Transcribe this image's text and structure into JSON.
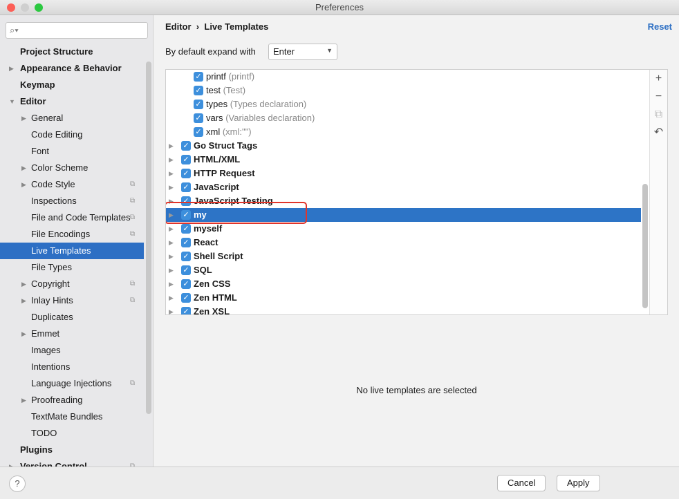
{
  "window": {
    "title": "Preferences"
  },
  "search": {
    "placeholder": "",
    "icon": "search-icon"
  },
  "sidebar": {
    "items": [
      {
        "label": "Project Structure",
        "level": 0,
        "bold": true,
        "arrow": ""
      },
      {
        "label": "Appearance & Behavior",
        "level": 0,
        "bold": true,
        "arrow": "▶"
      },
      {
        "label": "Keymap",
        "level": 0,
        "bold": true,
        "arrow": ""
      },
      {
        "label": "Editor",
        "level": 0,
        "bold": true,
        "arrow": "▼"
      },
      {
        "label": "General",
        "level": 1,
        "arrow": "▶"
      },
      {
        "label": "Code Editing",
        "level": 1,
        "arrow": ""
      },
      {
        "label": "Font",
        "level": 1,
        "arrow": ""
      },
      {
        "label": "Color Scheme",
        "level": 1,
        "arrow": "▶"
      },
      {
        "label": "Code Style",
        "level": 1,
        "arrow": "▶",
        "project": true
      },
      {
        "label": "Inspections",
        "level": 1,
        "arrow": "",
        "project": true
      },
      {
        "label": "File and Code Templates",
        "level": 1,
        "arrow": "",
        "project": true
      },
      {
        "label": "File Encodings",
        "level": 1,
        "arrow": "",
        "project": true
      },
      {
        "label": "Live Templates",
        "level": 1,
        "arrow": "",
        "selected": true
      },
      {
        "label": "File Types",
        "level": 1,
        "arrow": ""
      },
      {
        "label": "Copyright",
        "level": 1,
        "arrow": "▶",
        "project": true
      },
      {
        "label": "Inlay Hints",
        "level": 1,
        "arrow": "▶",
        "project": true
      },
      {
        "label": "Duplicates",
        "level": 1,
        "arrow": ""
      },
      {
        "label": "Emmet",
        "level": 1,
        "arrow": "▶"
      },
      {
        "label": "Images",
        "level": 1,
        "arrow": ""
      },
      {
        "label": "Intentions",
        "level": 1,
        "arrow": ""
      },
      {
        "label": "Language Injections",
        "level": 1,
        "arrow": "",
        "project": true
      },
      {
        "label": "Proofreading",
        "level": 1,
        "arrow": "▶"
      },
      {
        "label": "TextMate Bundles",
        "level": 1,
        "arrow": ""
      },
      {
        "label": "TODO",
        "level": 1,
        "arrow": ""
      },
      {
        "label": "Plugins",
        "level": 0,
        "bold": true,
        "arrow": ""
      },
      {
        "label": "Version Control",
        "level": 0,
        "bold": true,
        "arrow": "▶",
        "project": true
      }
    ]
  },
  "main": {
    "breadcrumb": [
      "Editor",
      "Live Templates"
    ],
    "breadcrumb_sep": "›",
    "reset_label": "Reset",
    "expand_label": "By default expand with",
    "expand_value": "Enter",
    "empty_text": "No live templates are selected",
    "templates": [
      {
        "name": "printf",
        "desc": "(printf)",
        "child": true
      },
      {
        "name": "test",
        "desc": "(Test)",
        "child": true
      },
      {
        "name": "types",
        "desc": "(Types declaration)",
        "child": true
      },
      {
        "name": "vars",
        "desc": "(Variables declaration)",
        "child": true
      },
      {
        "name": "xml",
        "desc": "(xml:\"\")",
        "child": true
      },
      {
        "name": "Go Struct Tags",
        "group": true
      },
      {
        "name": "HTML/XML",
        "group": true
      },
      {
        "name": "HTTP Request",
        "group": true
      },
      {
        "name": "JavaScript",
        "group": true
      },
      {
        "name": "JavaScript Testing",
        "group": true
      },
      {
        "name": "my",
        "group": true,
        "selected": true
      },
      {
        "name": "myself",
        "group": true
      },
      {
        "name": "React",
        "group": true
      },
      {
        "name": "Shell Script",
        "group": true
      },
      {
        "name": "SQL",
        "group": true
      },
      {
        "name": "Zen CSS",
        "group": true
      },
      {
        "name": "Zen HTML",
        "group": true
      },
      {
        "name": "Zen XSL",
        "group": true
      }
    ],
    "toolbar": [
      {
        "icon": "plus-icon",
        "glyph": "+"
      },
      {
        "icon": "minus-icon",
        "glyph": "−"
      },
      {
        "icon": "copy-icon",
        "glyph": "⧉"
      },
      {
        "icon": "undo-icon",
        "glyph": "↶"
      }
    ]
  },
  "footer": {
    "help": "?",
    "cancel_label": "Cancel",
    "apply_label": "Apply"
  },
  "colors": {
    "accent": "#2d6fc4",
    "highlight_box": "#e0352b",
    "checkbox": "#3d8fdc"
  }
}
